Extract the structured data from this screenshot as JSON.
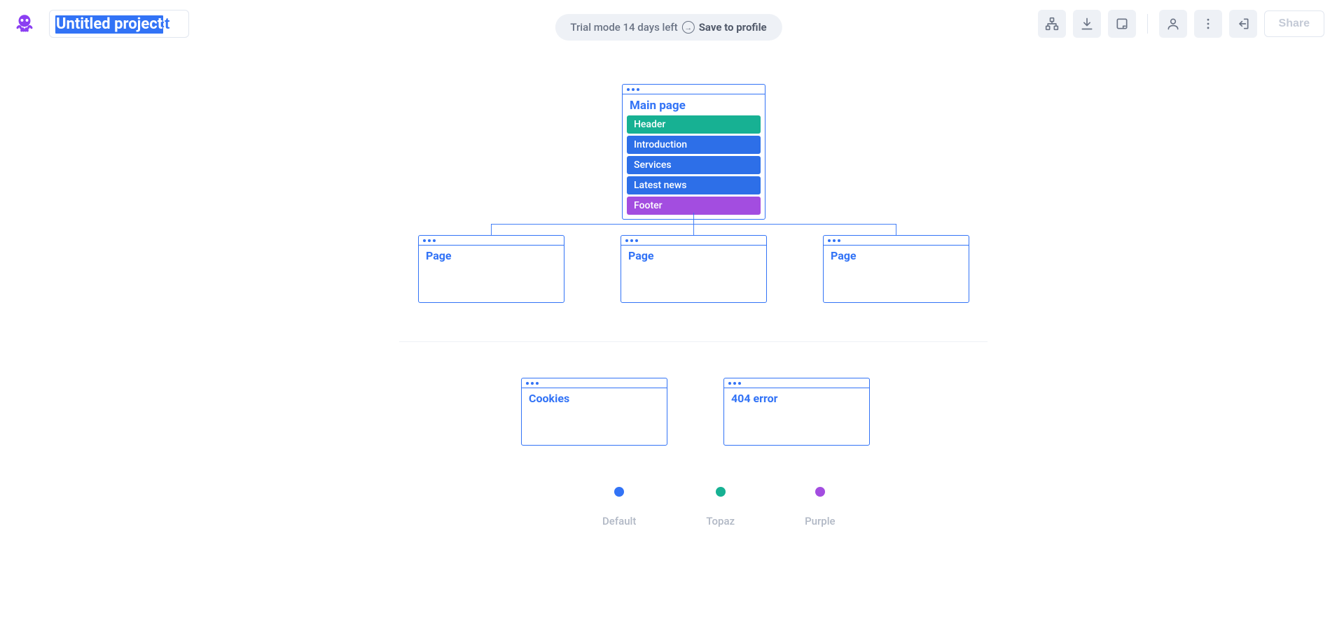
{
  "header": {
    "project_title": "Untitled project",
    "trial_text": "Trial mode 14 days left",
    "save_text": "Save to profile",
    "share_label": "Share"
  },
  "colors": {
    "default": "#3273f6",
    "topaz": "#17b193",
    "purple": "#a34de0"
  },
  "sitemap": {
    "main": {
      "title": "Main page",
      "sections": [
        {
          "label": "Header",
          "color": "#17b193"
        },
        {
          "label": "Introduction",
          "color": "#2d6fe8"
        },
        {
          "label": "Services",
          "color": "#2d6fe8"
        },
        {
          "label": "Latest news",
          "color": "#2d6fe8"
        },
        {
          "label": "Footer",
          "color": "#a34de0"
        }
      ]
    },
    "children": [
      {
        "title": "Page"
      },
      {
        "title": "Page"
      },
      {
        "title": "Page"
      }
    ],
    "extras": [
      {
        "title": "Cookies"
      },
      {
        "title": "404 error"
      }
    ]
  },
  "legend": [
    {
      "label": "Default",
      "color": "#3273f6"
    },
    {
      "label": "Topaz",
      "color": "#17b193"
    },
    {
      "label": "Purple",
      "color": "#a34de0"
    }
  ]
}
